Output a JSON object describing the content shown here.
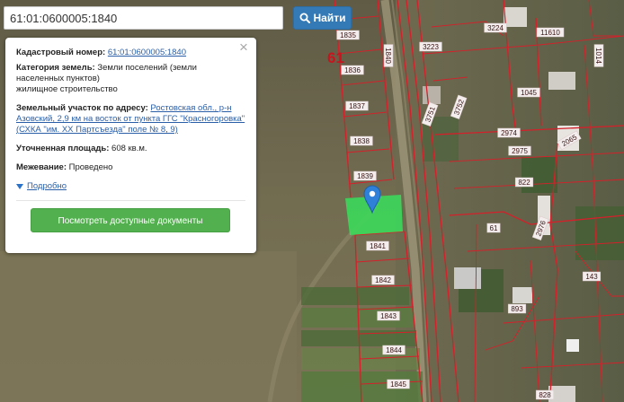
{
  "search": {
    "value": "61:01:0600005:1840",
    "button_label": "Найти"
  },
  "popup": {
    "close_glyph": "×",
    "cadastral_label": "Кадастровый номер:",
    "cadastral_value": "61:01:0600005:1840",
    "category_label": "Категория земель:",
    "category_value": "Земли поселений (земли населенных пунктов)",
    "use_value": "жилищное строительство",
    "address_label": "Земельный участок по адресу:",
    "address_value": "Ростовская обл., р-н Азовский, 2,9 км на восток от пункта ГГС \"Красногоровка\" (СХКА \"им. XX Партсъезда\" поле № 8, 9)",
    "area_label": "Уточненная площадь:",
    "area_value": "608 кв.м.",
    "survey_label": "Межевание:",
    "survey_value": "Проведено",
    "details_label": "Подробно",
    "docs_button_label": "Посмотреть доступные документы"
  },
  "map": {
    "quarter_label": "61",
    "plots": [
      "1835",
      "1836",
      "1837",
      "1838",
      "1839",
      "1841",
      "1842",
      "1843",
      "1844",
      "1845",
      "1840",
      "3223",
      "3224",
      "11610",
      "1014",
      "1045",
      "2974",
      "2975",
      "822",
      "61",
      "143",
      "893",
      "828",
      "2065",
      "2976",
      "3752",
      "3751"
    ],
    "colors": {
      "highlight": "#3cd85a",
      "boundary": "#d4202a",
      "marker": "#2f80d8"
    }
  }
}
